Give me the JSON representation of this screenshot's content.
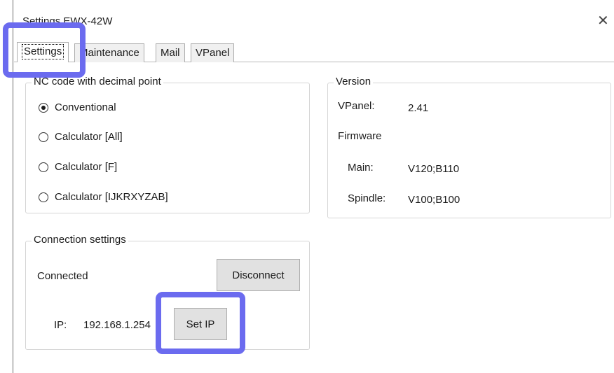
{
  "window": {
    "title": "Settings EWX-42W",
    "close_glyph": "✕"
  },
  "tabs": [
    {
      "label": "Settings",
      "active": true
    },
    {
      "label": "Maintenance",
      "active": false
    },
    {
      "label": "Mail",
      "active": false
    },
    {
      "label": "VPanel",
      "active": false
    }
  ],
  "nc_group": {
    "title": "NC code with decimal point",
    "options": [
      {
        "label": "Conventional",
        "checked": true
      },
      {
        "label": "Calculator [All]",
        "checked": false
      },
      {
        "label": "Calculator [F]",
        "checked": false
      },
      {
        "label": "Calculator [IJKRXYZAB]",
        "checked": false
      }
    ]
  },
  "version_group": {
    "title": "Version",
    "vpanel_label": "VPanel:",
    "vpanel_value": "2.41",
    "firmware_label": "Firmware",
    "main_label": "Main:",
    "main_value": "V120;B110",
    "spindle_label": "Spindle:",
    "spindle_value": "V100;B100"
  },
  "connection_group": {
    "title": "Connection settings",
    "status": "Connected",
    "disconnect_label": "Disconnect",
    "ip_label": "IP:",
    "ip_value": "192.168.1.254",
    "set_ip_label": "Set IP"
  },
  "colors": {
    "highlight": "#6b6bef",
    "button_bg": "#e1e1e1"
  }
}
